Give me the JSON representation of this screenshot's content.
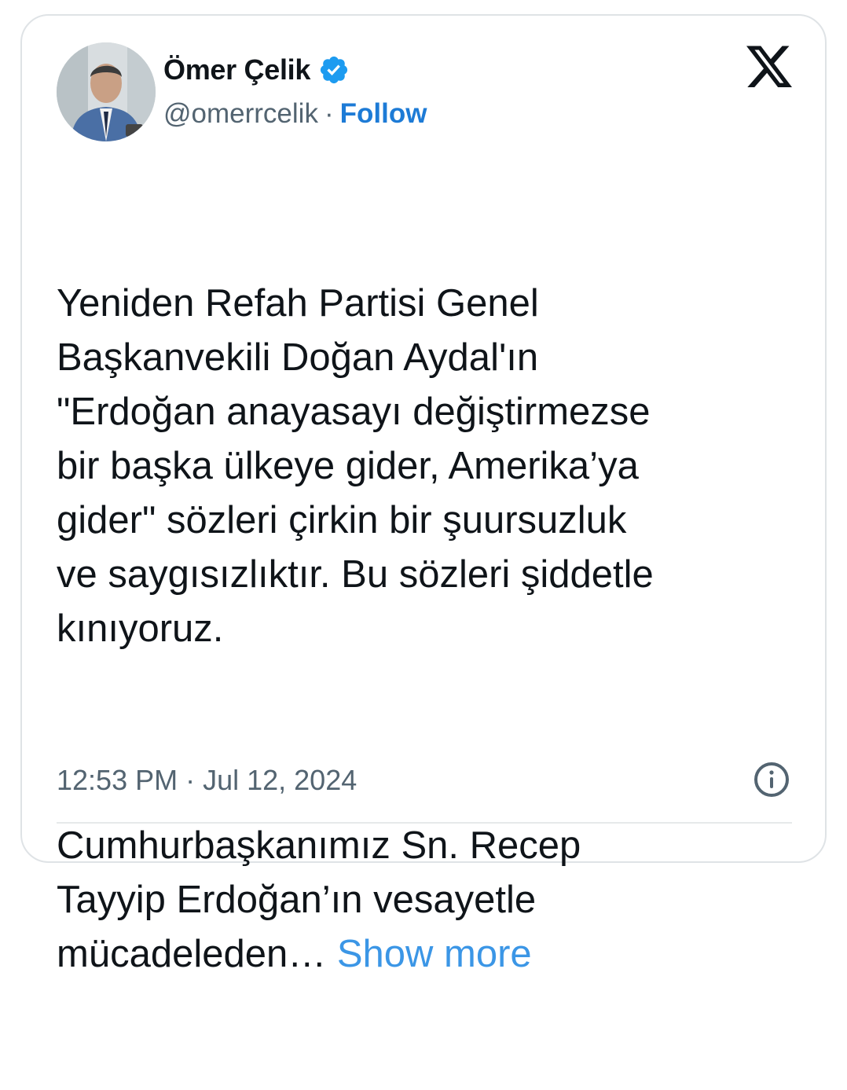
{
  "author": {
    "display_name": "Ömer Çelik",
    "handle": "@omerrcelik",
    "separator": "·",
    "follow_label": "Follow",
    "verified": true,
    "verified_color": "#1d9bf0"
  },
  "tweet": {
    "paragraph1": "Yeniden Refah Partisi Genel\nBaşkanvekili Doğan Aydal'ın\n\"Erdoğan anayasayı değiştirmezse\nbir başka ülkeye gider, Amerika’ya\ngider\" sözleri çirkin bir şuursuzluk\nve saygısızlıktır. Bu sözleri şiddetle\nkınıyoruz.",
    "paragraph2": "Cumhurbaşkanımız Sn. Recep\nTayyip Erdoğan’ın vesayetle\nmücadeleden… ",
    "show_more_label": "Show more",
    "timestamp": "12:53 PM · Jul 12, 2024"
  },
  "icons": {
    "logo": "x-logo-icon",
    "verified": "verified-badge-icon",
    "info": "info-icon"
  },
  "colors": {
    "link": "#1d7bd6",
    "show_more": "#3b96e6",
    "secondary_text": "#536471",
    "border": "#dfe3e6"
  }
}
